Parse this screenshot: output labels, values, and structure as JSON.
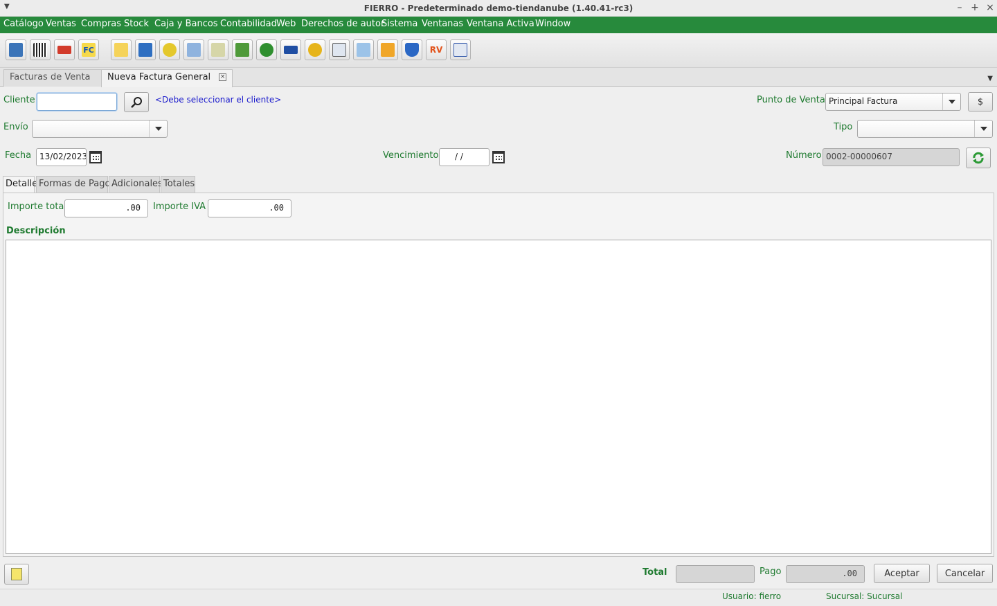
{
  "window": {
    "title": "FIERRO - Predeterminado demo-tiendanube (1.40.41-rc3)",
    "minimize": "–",
    "maximize": "+",
    "close": "×"
  },
  "menu": [
    "Catálogo",
    "Ventas",
    "Compras",
    "Stock",
    "Caja y Bancos",
    "Contabilidad",
    "Web",
    "Derechos de autor",
    "Sistema",
    "Ventanas",
    "Ventana Activa",
    "Window"
  ],
  "toolbar": {
    "icons": [
      "book-icon",
      "barcode-icon",
      "truck-icon",
      "fc-icon",
      "document-icon",
      "save-icon",
      "coin-icon",
      "invoice-icon",
      "percent-icon",
      "hash-edit-icon",
      "dollar-icon",
      "card-icon",
      "user-icon",
      "copy-icon",
      "mail-icon",
      "money-icon",
      "shield-icon",
      "rv-icon",
      "calc-icon"
    ],
    "fc_text": "FC",
    "rv_text": "RV"
  },
  "doc_tabs": [
    {
      "label": "Facturas de Venta",
      "active": false
    },
    {
      "label": "Nueva Factura General",
      "active": true,
      "close": "×"
    }
  ],
  "form": {
    "cliente_label": "Cliente",
    "cliente_value": "",
    "cliente_hint": "<Debe seleccionar el cliente>",
    "punto_venta_label": "Punto de Venta",
    "punto_venta_value": "Principal Factura",
    "currency_button": "$",
    "envio_label": "Envío",
    "envio_value": "",
    "tipo_label": "Tipo",
    "tipo_value": "",
    "fecha_label": "Fecha",
    "fecha_value": "13/02/2023",
    "vencimiento_label": "Vencimiento",
    "vencimiento_value": " /  /",
    "numero_label": "Número",
    "numero_value": "0002-00000607"
  },
  "inner_tabs": [
    "Detalle",
    "Formas de Pago",
    "Adicionales",
    "Totales"
  ],
  "detalle": {
    "importe_total_label": "Importe total",
    "importe_total_value": ".00",
    "importe_iva_label": "Importe IVA",
    "importe_iva_value": ".00",
    "descripcion_label": "Descripción"
  },
  "footer": {
    "total_label": "Total",
    "total_value": "",
    "pago_label": "Pago",
    "pago_value": ".00",
    "accept": "Aceptar",
    "cancel": "Cancelar"
  },
  "status": {
    "usuario": "Usuario: fierro",
    "sucursal": "Sucursal: Sucursal"
  }
}
